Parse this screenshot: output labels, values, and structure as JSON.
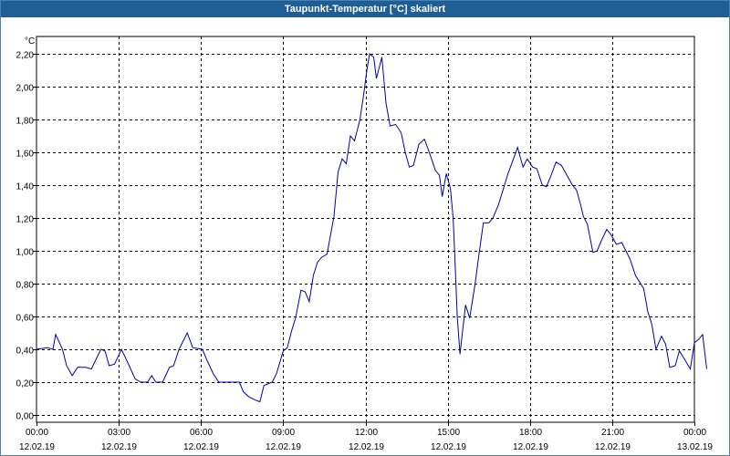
{
  "window": {
    "title": "Taupunkt-Temperatur [°C] skaliert"
  },
  "chart_data": {
    "type": "line",
    "title": "Taupunkt-Temperatur [°C] skaliert",
    "ylabel": "°C",
    "xlabel": "",
    "ylim": [
      0,
      2.2
    ],
    "xlim": [
      0,
      24
    ],
    "grid": true,
    "yticks": [
      {
        "v": 0,
        "label": "0,00"
      },
      {
        "v": 0.2,
        "label": "0,20"
      },
      {
        "v": 0.4,
        "label": "0,40"
      },
      {
        "v": 0.6,
        "label": "0,60"
      },
      {
        "v": 0.8,
        "label": "0,80"
      },
      {
        "v": 1.0,
        "label": "1,00"
      },
      {
        "v": 1.2,
        "label": "1,20"
      },
      {
        "v": 1.4,
        "label": "1,40"
      },
      {
        "v": 1.6,
        "label": "1,60"
      },
      {
        "v": 1.8,
        "label": "1,80"
      },
      {
        "v": 2.0,
        "label": "2,00"
      },
      {
        "v": 2.2,
        "label": "2,20"
      }
    ],
    "xticks": [
      {
        "v": 0,
        "time": "00:00",
        "date": "12.02.19"
      },
      {
        "v": 3,
        "time": "03:00",
        "date": "12.02.19"
      },
      {
        "v": 6,
        "time": "06:00",
        "date": "12.02.19"
      },
      {
        "v": 9,
        "time": "09:00",
        "date": "12.02.19"
      },
      {
        "v": 12,
        "time": "12:00",
        "date": "12.02.19"
      },
      {
        "v": 15,
        "time": "15:00",
        "date": "12.02.19"
      },
      {
        "v": 18,
        "time": "18:00",
        "date": "12.02.19"
      },
      {
        "v": 21,
        "time": "21:00",
        "date": "12.02.19"
      },
      {
        "v": 24,
        "time": "00:00",
        "date": "13.02.19"
      }
    ],
    "series": [
      {
        "color": "#0000aa",
        "points": [
          [
            0.0,
            0.4
          ],
          [
            0.4,
            0.41
          ],
          [
            0.6,
            0.4
          ],
          [
            0.7,
            0.49
          ],
          [
            0.95,
            0.4
          ],
          [
            1.1,
            0.3
          ],
          [
            1.3,
            0.24
          ],
          [
            1.5,
            0.29
          ],
          [
            1.8,
            0.29
          ],
          [
            2.0,
            0.28
          ],
          [
            2.35,
            0.4
          ],
          [
            2.5,
            0.39
          ],
          [
            2.65,
            0.3
          ],
          [
            2.85,
            0.31
          ],
          [
            3.1,
            0.4
          ],
          [
            3.3,
            0.33
          ],
          [
            3.6,
            0.22
          ],
          [
            3.8,
            0.2
          ],
          [
            4.05,
            0.2
          ],
          [
            4.2,
            0.24
          ],
          [
            4.35,
            0.2
          ],
          [
            4.6,
            0.2
          ],
          [
            4.85,
            0.29
          ],
          [
            5.0,
            0.3
          ],
          [
            5.2,
            0.4
          ],
          [
            5.5,
            0.5
          ],
          [
            5.7,
            0.41
          ],
          [
            6.05,
            0.4
          ],
          [
            6.2,
            0.34
          ],
          [
            6.45,
            0.25
          ],
          [
            6.65,
            0.2
          ],
          [
            7.0,
            0.2
          ],
          [
            7.4,
            0.2
          ],
          [
            7.55,
            0.14
          ],
          [
            7.75,
            0.11
          ],
          [
            8.0,
            0.09
          ],
          [
            8.15,
            0.08
          ],
          [
            8.3,
            0.18
          ],
          [
            8.6,
            0.2
          ],
          [
            8.75,
            0.25
          ],
          [
            9.0,
            0.39
          ],
          [
            9.15,
            0.41
          ],
          [
            9.3,
            0.51
          ],
          [
            9.45,
            0.59
          ],
          [
            9.65,
            0.76
          ],
          [
            9.8,
            0.75
          ],
          [
            9.95,
            0.69
          ],
          [
            10.1,
            0.85
          ],
          [
            10.25,
            0.93
          ],
          [
            10.4,
            0.96
          ],
          [
            10.6,
            0.98
          ],
          [
            10.85,
            1.21
          ],
          [
            11.0,
            1.48
          ],
          [
            11.15,
            1.56
          ],
          [
            11.3,
            1.53
          ],
          [
            11.45,
            1.7
          ],
          [
            11.6,
            1.67
          ],
          [
            11.8,
            1.8
          ],
          [
            11.95,
            1.97
          ],
          [
            12.05,
            2.1
          ],
          [
            12.15,
            2.2
          ],
          [
            12.3,
            2.18
          ],
          [
            12.4,
            2.05
          ],
          [
            12.6,
            2.18
          ],
          [
            12.75,
            1.9
          ],
          [
            12.9,
            1.76
          ],
          [
            13.1,
            1.77
          ],
          [
            13.3,
            1.72
          ],
          [
            13.45,
            1.6
          ],
          [
            13.6,
            1.51
          ],
          [
            13.75,
            1.52
          ],
          [
            13.95,
            1.65
          ],
          [
            14.15,
            1.68
          ],
          [
            14.35,
            1.59
          ],
          [
            14.55,
            1.49
          ],
          [
            14.7,
            1.46
          ],
          [
            14.8,
            1.33
          ],
          [
            14.95,
            1.47
          ],
          [
            15.1,
            1.38
          ],
          [
            15.2,
            1.2
          ],
          [
            15.25,
            1.01
          ],
          [
            15.35,
            0.6
          ],
          [
            15.45,
            0.37
          ],
          [
            15.55,
            0.52
          ],
          [
            15.65,
            0.67
          ],
          [
            15.8,
            0.59
          ],
          [
            16.0,
            0.8
          ],
          [
            16.15,
            0.99
          ],
          [
            16.3,
            1.17
          ],
          [
            16.5,
            1.17
          ],
          [
            16.65,
            1.2
          ],
          [
            16.85,
            1.28
          ],
          [
            17.0,
            1.36
          ],
          [
            17.2,
            1.47
          ],
          [
            17.4,
            1.56
          ],
          [
            17.55,
            1.63
          ],
          [
            17.75,
            1.51
          ],
          [
            17.9,
            1.56
          ],
          [
            18.1,
            1.51
          ],
          [
            18.25,
            1.5
          ],
          [
            18.45,
            1.4
          ],
          [
            18.6,
            1.39
          ],
          [
            18.75,
            1.45
          ],
          [
            18.95,
            1.54
          ],
          [
            19.15,
            1.52
          ],
          [
            19.35,
            1.46
          ],
          [
            19.55,
            1.4
          ],
          [
            19.7,
            1.37
          ],
          [
            19.85,
            1.28
          ],
          [
            19.95,
            1.21
          ],
          [
            20.1,
            1.16
          ],
          [
            20.3,
            0.99
          ],
          [
            20.45,
            1.0
          ],
          [
            20.6,
            1.06
          ],
          [
            20.8,
            1.13
          ],
          [
            20.95,
            1.1
          ],
          [
            21.15,
            1.04
          ],
          [
            21.35,
            1.05
          ],
          [
            21.5,
            1.0
          ],
          [
            21.65,
            0.95
          ],
          [
            21.85,
            0.85
          ],
          [
            22.0,
            0.81
          ],
          [
            22.15,
            0.77
          ],
          [
            22.3,
            0.63
          ],
          [
            22.45,
            0.55
          ],
          [
            22.6,
            0.4
          ],
          [
            22.8,
            0.48
          ],
          [
            22.95,
            0.43
          ],
          [
            23.1,
            0.29
          ],
          [
            23.3,
            0.3
          ],
          [
            23.45,
            0.39
          ],
          [
            23.6,
            0.35
          ],
          [
            23.85,
            0.28
          ],
          [
            24.0,
            0.44
          ],
          [
            24.15,
            0.46
          ],
          [
            24.3,
            0.49
          ],
          [
            24.45,
            0.28
          ]
        ]
      }
    ]
  }
}
